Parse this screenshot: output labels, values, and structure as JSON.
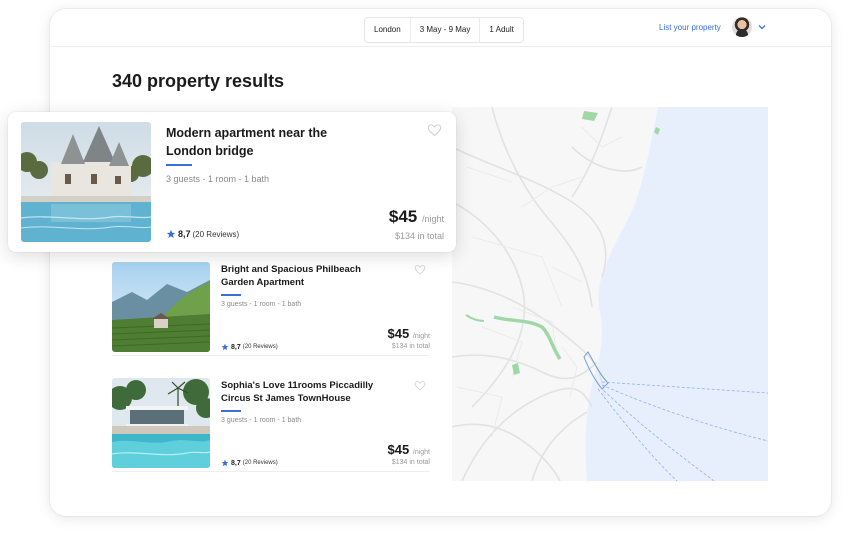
{
  "header": {
    "search": {
      "location": "London",
      "dates": "3 May - 9 May",
      "guests": "1 Adult"
    },
    "list_property_label": "List your property"
  },
  "results_title": "340 property results",
  "colors": {
    "accent": "#3b6fd8",
    "map_water": "#e8effc",
    "map_park": "#9fd8a6"
  },
  "listings": [
    {
      "title": "Modern apartment near the London bridge",
      "meta": "3 guests - 1 room - 1 bath",
      "rating": "8,7",
      "reviews": "(20 Reviews)",
      "price": "$45",
      "per": "/night",
      "total": "$134 in total"
    },
    {
      "title": "Bright and Spacious Philbeach Garden Apartment",
      "meta": "3 guests - 1 room - 1 bath",
      "rating": "8,7",
      "reviews": "(20 Reviews)",
      "price": "$45",
      "per": "/night",
      "total": "$134 in total"
    },
    {
      "title": "Sophia's Love 11rooms Piccadilly Circus St James TownHouse",
      "meta": "3 guests - 1 room - 1 bath",
      "rating": "8,7",
      "reviews": "(20 Reviews)",
      "price": "$45",
      "per": "/night",
      "total": "$134 in total"
    }
  ]
}
